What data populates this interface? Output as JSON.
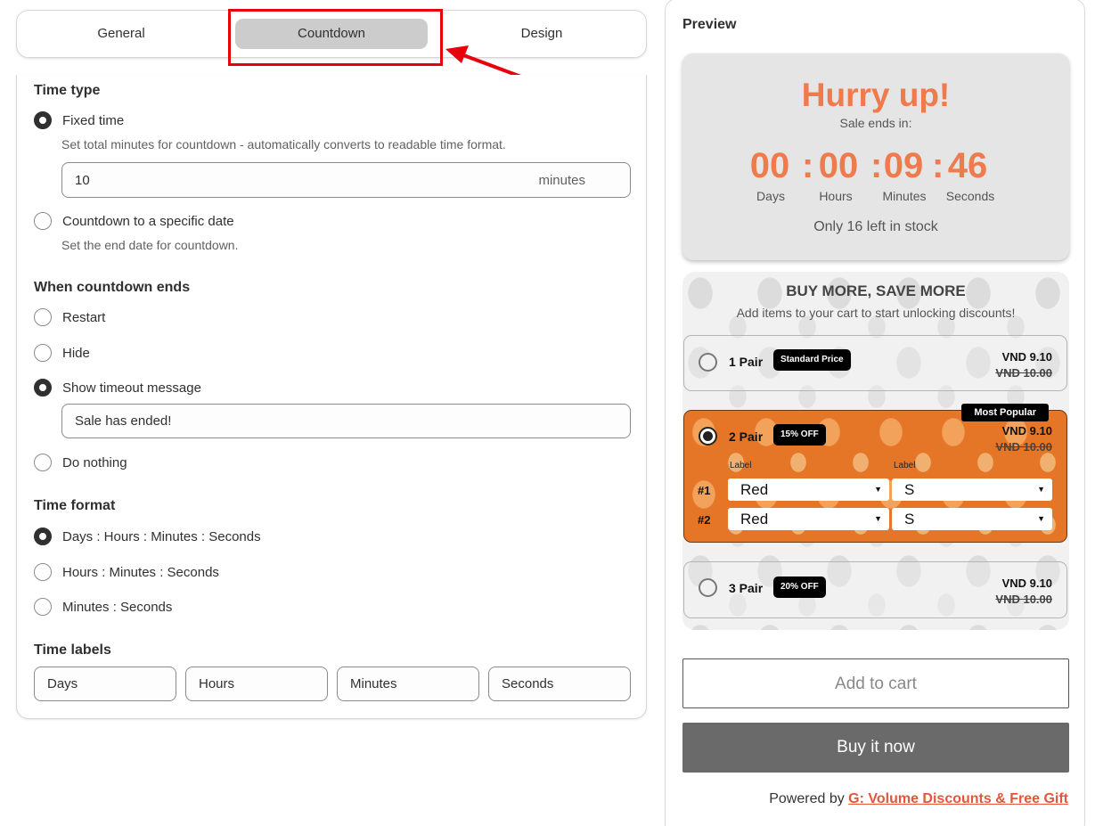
{
  "tabs": [
    {
      "label": "General"
    },
    {
      "label": "Countdown"
    },
    {
      "label": "Design"
    }
  ],
  "settings": {
    "time_type": {
      "title": "Time type",
      "fixed_label": "Fixed time",
      "fixed_help": "Set total minutes for countdown - automatically converts to readable time format.",
      "minutes_value": "10",
      "minutes_suffix": "minutes",
      "specific_label": "Countdown to a specific date",
      "specific_help": "Set the end date for countdown."
    },
    "when_ends": {
      "title": "When countdown ends",
      "restart": "Restart",
      "hide": "Hide",
      "show_message": "Show timeout message",
      "message_value": "Sale has ended!",
      "do_nothing": "Do nothing"
    },
    "time_format": {
      "title": "Time format",
      "dhms": "Days : Hours : Minutes : Seconds",
      "hms": "Hours : Minutes : Seconds",
      "ms": "Minutes : Seconds"
    },
    "time_labels": {
      "title": "Time labels",
      "days": "Days",
      "hours": "Hours",
      "minutes": "Minutes",
      "seconds": "Seconds"
    }
  },
  "preview": {
    "title": "Preview",
    "timer": {
      "headline": "Hurry up!",
      "subtext": "Sale ends in:",
      "days": "00",
      "hours": "00",
      "minutes": "09",
      "seconds": "46",
      "sep": ":",
      "label_days": "Days",
      "label_hours": "Hours",
      "label_minutes": "Minutes",
      "label_seconds": "Seconds",
      "stock_text": "Only 16 left in stock"
    },
    "bundle": {
      "title": "BUY MORE, SAVE MORE",
      "subtitle": "Add items to your cart to start unlocking discounts!",
      "options": [
        {
          "name": "1 Pair",
          "badge": "Standard Price",
          "price": "VND 9.10",
          "compare": "VND 10.00"
        },
        {
          "name": "2 Pair",
          "badge": "15% OFF",
          "price": "VND 9.10",
          "compare": "VND 10.00",
          "popular": "Most Popular"
        },
        {
          "name": "3 Pair",
          "badge": "20% OFF",
          "price": "VND 9.10",
          "compare": "VND 10.00"
        }
      ],
      "variant_label": "Label",
      "variants": [
        {
          "num": "#1",
          "color": "Red",
          "size": "S"
        },
        {
          "num": "#2",
          "color": "Red",
          "size": "S"
        }
      ]
    },
    "add_to_cart": "Add to cart",
    "buy_now": "Buy it now",
    "powered_prefix": "Powered by ",
    "powered_link": "G: Volume Discounts & Free Gift"
  },
  "colors": {
    "accent": "#ef7a4c",
    "selected_option_bg": "#e57628",
    "annotation_red": "#e8000b",
    "active_tab_bg": "#cccccc"
  }
}
